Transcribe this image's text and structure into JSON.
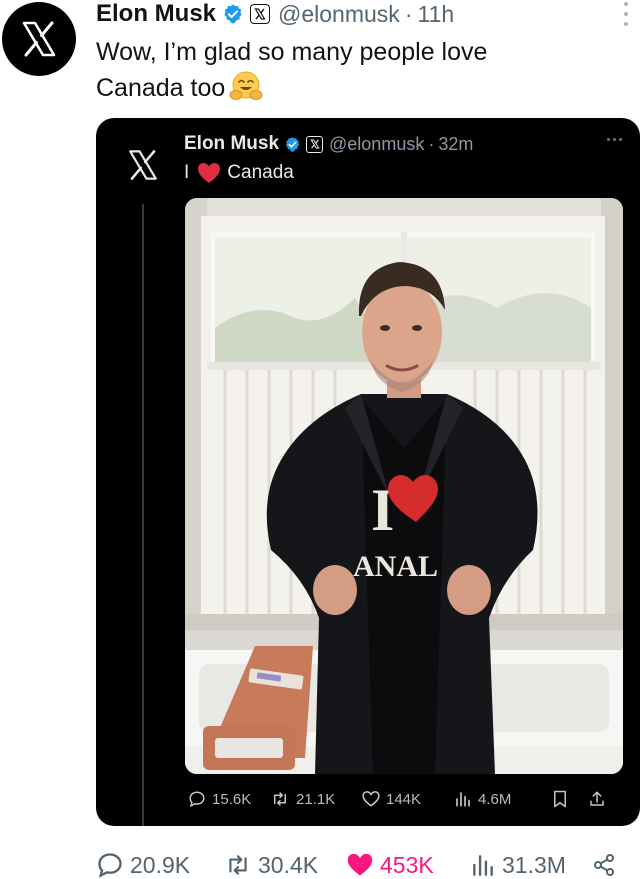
{
  "post": {
    "author_name": "Elon Musk",
    "handle": "@elonmusk",
    "separator": "·",
    "time": "11h",
    "text_line1": "Wow, I’m glad so many people love",
    "text_line2": "Canada too"
  },
  "quoted": {
    "author_name": "Elon Musk",
    "handle": "@elonmusk",
    "separator": "·",
    "time": "32m",
    "text_prefix": "I",
    "text_suffix": "Canada",
    "shirt_text": "ANAL",
    "stats": {
      "replies": "15.6K",
      "reposts": "21.1K",
      "likes": "144K",
      "views": "4.6M"
    }
  },
  "stats": {
    "replies": "20.9K",
    "reposts": "30.4K",
    "likes": "453K",
    "views": "31.3M"
  },
  "colors": {
    "verified": "#1d9bf0",
    "like_active": "#f91880",
    "text_secondary": "#536471",
    "card_bg": "#000000"
  },
  "icons": [
    "x-logo-icon",
    "verified-badge-icon",
    "x-affiliate-badge-icon",
    "more-options-icon",
    "hugging-face-emoji-icon",
    "red-heart-emoji-icon",
    "reply-icon",
    "repost-icon",
    "like-icon",
    "views-icon",
    "bookmark-icon",
    "share-icon"
  ]
}
